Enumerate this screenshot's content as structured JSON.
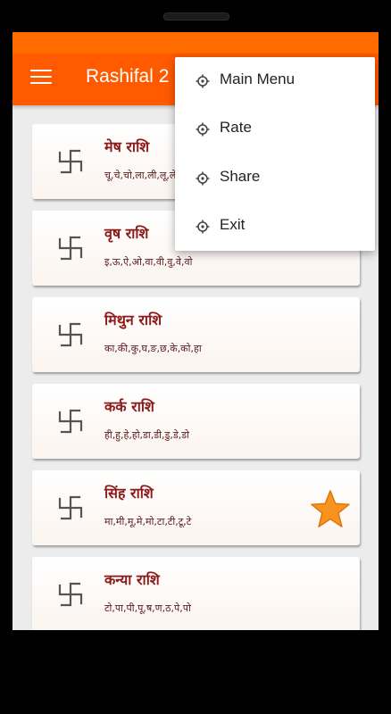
{
  "app_bar": {
    "title": "Rashifal 2",
    "menu_icon": "hamburger-menu-icon",
    "color": "#ff5a00"
  },
  "dropdown_menu": {
    "items": [
      {
        "label": "Main Menu",
        "icon": "gear-icon"
      },
      {
        "label": "Rate",
        "icon": "gear-icon"
      },
      {
        "label": "Share",
        "icon": "gear-icon"
      },
      {
        "label": "Exit",
        "icon": "gear-icon"
      }
    ]
  },
  "rashi_list": [
    {
      "name": "मेष राशि",
      "letters": "चू,चे,चो,ला,ली,लू,ले,लो,अ",
      "icon": "swastika-icon"
    },
    {
      "name": "वृष राशि",
      "letters": "इ,ऊ,ऐ,ओ,वा,वी,वु,वे,वो",
      "icon": "swastika-icon"
    },
    {
      "name": "मिथुन राशि",
      "letters": "का,की,कु,घ,ङ,छ,के,को,हा",
      "icon": "swastika-icon"
    },
    {
      "name": "कर्क राशि",
      "letters": "ही,हु,हे,हो,डा,डी,डु,डे,डो",
      "icon": "swastika-icon"
    },
    {
      "name": "सिंह राशि",
      "letters": "मा,मी,मू,मे,मो,टा,टी,टू,टे",
      "icon": "swastika-icon",
      "highlight": "star-icon"
    },
    {
      "name": "कन्या राशि",
      "letters": "टो,पा,पी,पू,ष,ण,ठ,पे,पो",
      "icon": "swastika-icon"
    }
  ],
  "colors": {
    "accent": "#ff5a00",
    "title_text": "#8b1a1a",
    "star": "#f7931e"
  }
}
